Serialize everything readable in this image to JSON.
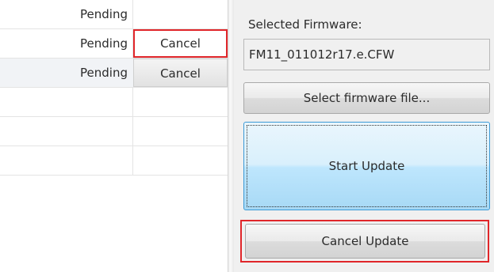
{
  "queue": {
    "rows": [
      {
        "status": "Pending",
        "action": ""
      },
      {
        "status": "Pending",
        "action": "Cancel"
      },
      {
        "status": "Pending",
        "action": "Cancel"
      },
      {
        "status": "",
        "action": ""
      },
      {
        "status": "",
        "action": ""
      },
      {
        "status": "",
        "action": ""
      }
    ]
  },
  "panel": {
    "selected_firmware_label": "Selected Firmware:",
    "firmware_file": "FM11_011012r17.e.CFW",
    "select_button": "Select firmware file...",
    "start_button": "Start Update",
    "cancel_button": "Cancel Update"
  },
  "colors": {
    "highlight": "#e0262a",
    "start_button_blue": "#bee6fd"
  }
}
